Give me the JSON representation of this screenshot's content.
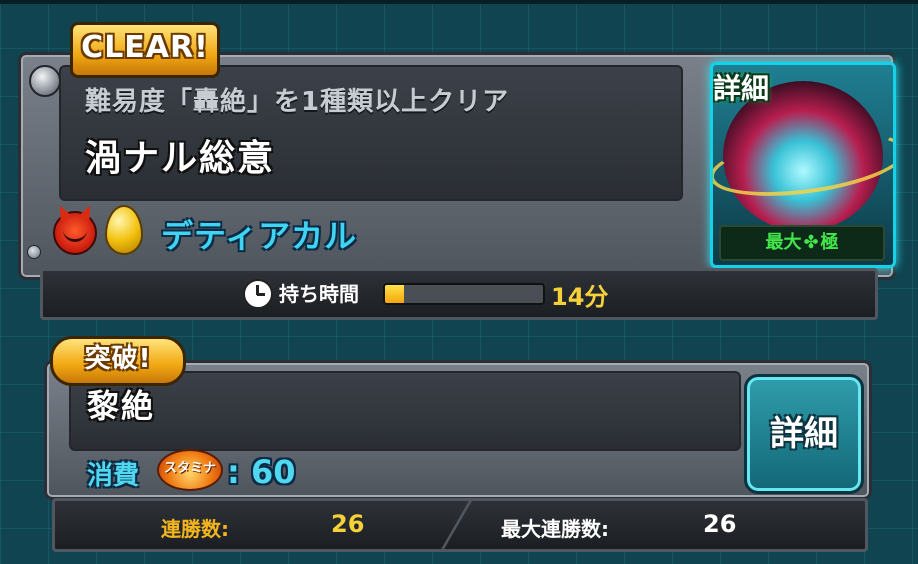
{
  "quest": {
    "badge": "CLEAR!",
    "condition": "難易度「轟絶」を1種類以上クリア",
    "name": "渦ナル総意",
    "monster_name": "デティアカル",
    "detail_label": "詳細",
    "grade_prefix": "最大",
    "grade_suffix": "極",
    "icons": [
      "devil-face-icon",
      "golden-egg-icon",
      "clover-icon"
    ]
  },
  "timer": {
    "label": "持ち時間",
    "value": "14分",
    "gauge_fraction": 0.12,
    "icon": "clock-icon"
  },
  "breakthrough": {
    "badge": "突破!",
    "name": "黎絶",
    "stamina_label": "消費",
    "stamina_icon_text": "スタミナ",
    "stamina_value": ": 60",
    "detail_button": "詳細"
  },
  "stats": {
    "win_streak_label": "連勝数:",
    "win_streak_value": "26",
    "max_streak_label": "最大連勝数:",
    "max_streak_value": "26"
  },
  "colors": {
    "accent_cyan": "#3fd4f2",
    "gold": "#f7d13a",
    "grade_green": "#42e64a"
  }
}
